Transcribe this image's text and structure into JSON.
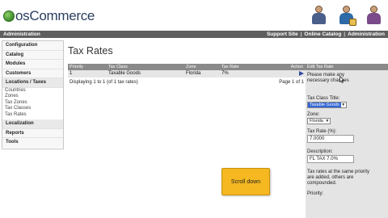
{
  "app": {
    "logo_text": "osCommerce"
  },
  "adminbar": {
    "left_label": "Administration",
    "links": [
      "Support Site",
      "Online Catalog",
      "Administration"
    ],
    "separator": "|"
  },
  "sidebar": {
    "sections": [
      {
        "label": "Configuration"
      },
      {
        "label": "Catalog"
      },
      {
        "label": "Modules"
      },
      {
        "label": "Customers"
      },
      {
        "label": "Locations / Taxes",
        "open": true,
        "items": [
          "Countries",
          "Zones",
          "Tax Zones",
          "Tax Classes",
          "Tax Rates"
        ]
      },
      {
        "label": "Localization"
      },
      {
        "label": "Reports"
      },
      {
        "label": "Tools"
      }
    ]
  },
  "page": {
    "title": "Tax Rates"
  },
  "table": {
    "headers": [
      "Priority",
      "Tax Class",
      "Zone",
      "Tax Rate",
      "Action"
    ],
    "rows": [
      {
        "priority": "1",
        "tax_class": "Taxable Goods",
        "zone": "Florida",
        "tax_rate": "7%"
      }
    ],
    "display_text": "Displaying 1 to 1 (of 1 tax rates)",
    "pager": "Page 1 of 1"
  },
  "edit_panel": {
    "header": "Edit Tax Rate",
    "intro": "Please make any necessary changes",
    "tax_class_label": "Tax Class Title:",
    "tax_class_value": "Taxable Goods",
    "zone_label": "Zone:",
    "zone_value": "Florida",
    "rate_label": "Tax Rate (%):",
    "rate_value": "7.0000",
    "desc_label": "Description:",
    "desc_value": "FL TAX 7.0%",
    "note": "Tax rates at the same priority are added, others are compounded.",
    "priority_label": "Priority:"
  },
  "overlay": {
    "scroll_label": "Scroll down"
  },
  "colors": {
    "accent_bar": "#5f5f5f",
    "table_header": "#8a8a8a",
    "scroll_button": "#f5b820"
  }
}
